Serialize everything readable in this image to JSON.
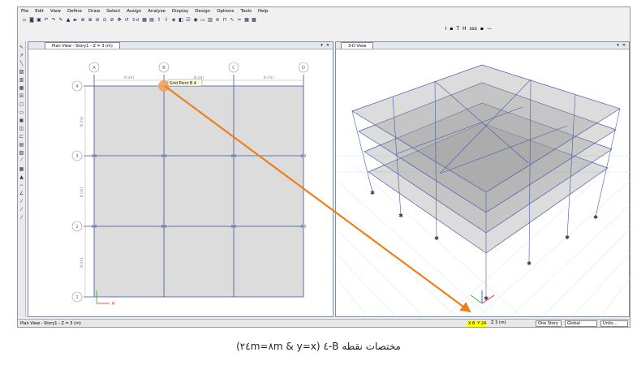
{
  "menu": [
    "File",
    "Edit",
    "View",
    "Define",
    "Draw",
    "Select",
    "Assign",
    "Analyze",
    "Display",
    "Design",
    "Options",
    "Tools",
    "Help"
  ],
  "toolbar": {
    "view_3d_label": "3-d",
    "secondary": [
      "I",
      "▪",
      "T",
      "H",
      "sss",
      "▪",
      "—"
    ]
  },
  "plan_view": {
    "tab_title": "Plan View - Story1 - Z = 3 (m)",
    "grid_columns": [
      "A",
      "B",
      "C",
      "D"
    ],
    "grid_rows": [
      "4",
      "3",
      "2",
      "1"
    ],
    "bay_label_x": "8 (m)",
    "bay_label_y": "8 (m)",
    "tooltip": "Grid Point  B  4"
  },
  "view_3d": {
    "tab_title": "3-D View"
  },
  "tab_controls": {
    "dropdown": "▾",
    "close": "✕"
  },
  "status": {
    "left": "Plan View - Story1 - Z = 3 (m)",
    "x": "X 8",
    "y": "Y 24",
    "z": "Z 3 (m)",
    "story_select": "One Story",
    "coord_select": "Global",
    "units_button": "Units..."
  },
  "caption": "مختصات نقطه B-٤ (x=٨m & y=٢٤m)",
  "colors": {
    "highlight_point": "#f4a25a",
    "arrow": "#ef7f1a",
    "coords_highlight": "#ffff00",
    "slab_fill": "#dcdcdc",
    "grid_line": "#3d4f9e"
  }
}
